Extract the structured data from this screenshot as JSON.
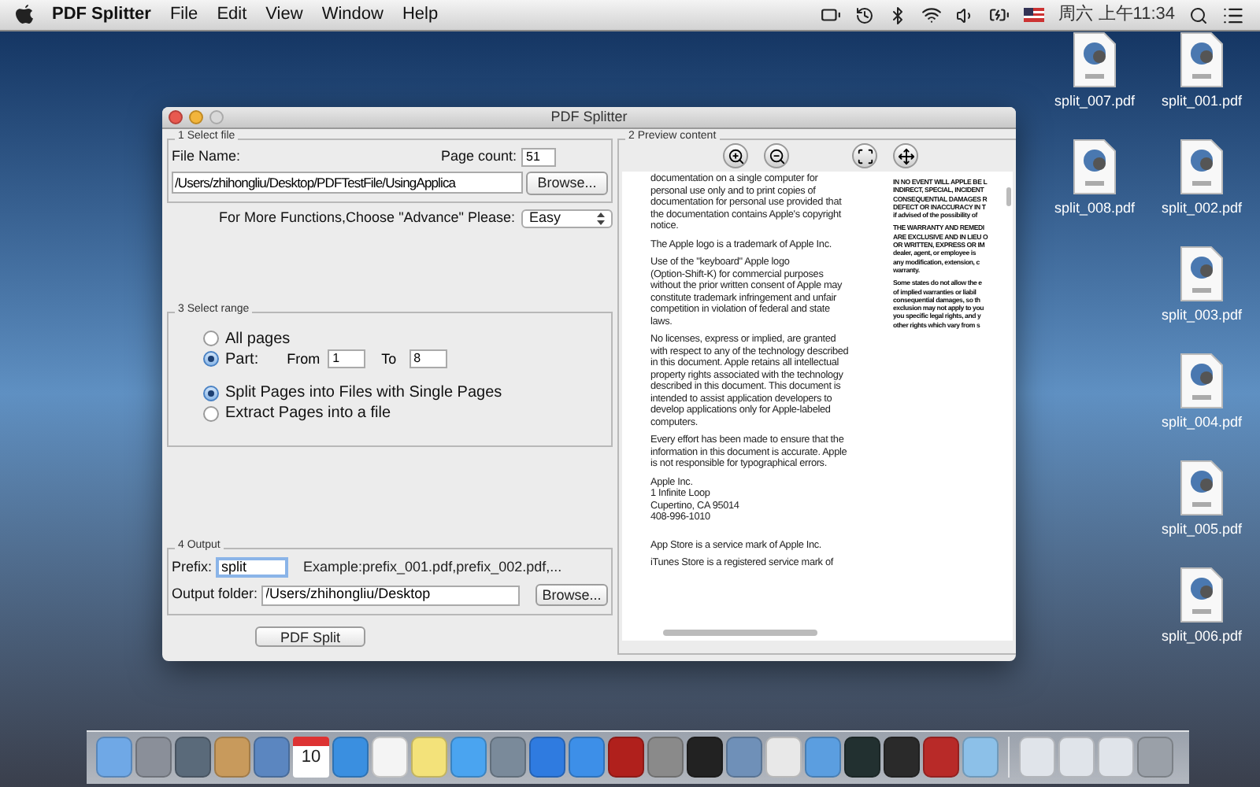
{
  "menu_bar": {
    "app_name": "PDF Splitter",
    "menus": [
      "File",
      "Edit",
      "View",
      "Window",
      "Help"
    ],
    "clock": "周六 上午11:34"
  },
  "window": {
    "title": "PDF Splitter",
    "select_file": {
      "legend": "1 Select file",
      "file_name_label": "File Name:",
      "page_count_label": "Page count:",
      "page_count": "51",
      "path": "/Users/zhihongliu/Desktop/PDFTestFile/UsingApplica",
      "browse": "Browse..."
    },
    "mode": {
      "label": "For More Functions,Choose \"Advance\" Please:",
      "value": "Easy"
    },
    "select_range": {
      "legend": "3 Select range",
      "range_options": [
        {
          "label": "All pages",
          "selected": false
        },
        {
          "label": "Part:",
          "selected": true
        }
      ],
      "from_label": "From",
      "from": "1",
      "to_label": "To",
      "to": "8",
      "split_options": [
        {
          "label": "Split Pages into Files with Single Pages",
          "selected": true
        },
        {
          "label": "Extract Pages into a file",
          "selected": false
        }
      ]
    },
    "output": {
      "legend": "4 Output",
      "prefix_label": "Prefix:",
      "prefix": "split",
      "example": "Example:prefix_001.pdf,prefix_002.pdf,...",
      "folder_label": "Output folder:",
      "folder": "/Users/zhihongliu/Desktop",
      "browse": "Browse..."
    },
    "split_button": "PDF Split",
    "preview": {
      "legend": "2 Preview content",
      "left_column": [
        [
          "documentation on a single computer for",
          "personal use only and to print copies of",
          "documentation for personal use provided that",
          "the documentation contains Apple's copyright",
          "notice."
        ],
        [
          "The Apple logo is a trademark of Apple Inc."
        ],
        [
          "Use of the \"keyboard\" Apple logo",
          "(Option-Shift-K) for commercial purposes",
          "without the prior written consent of Apple may",
          "constitute trademark infringement and unfair",
          "competition in violation of federal and state",
          "laws."
        ],
        [
          "No licenses, express or implied, are granted",
          "with respect to any of the technology described",
          "in this document. Apple retains all intellectual",
          "property rights associated with the technology",
          "described in this document. This document is",
          "intended to assist application developers to",
          "develop applications only for Apple-labeled",
          "computers."
        ],
        [
          "Every effort has been made to ensure that the",
          "information in this document is accurate. Apple",
          "is not responsible for typographical errors."
        ],
        [
          "Apple Inc.",
          "1 Infinite Loop",
          "Cupertino, CA 95014",
          "408-996-1010"
        ],
        [
          "App Store is a service mark of Apple Inc."
        ],
        [
          "iTunes Store is a registered service mark of"
        ]
      ],
      "right_column": [
        [
          "IN NO EVENT WILL APPLE BE L",
          "INDIRECT, SPECIAL, INCIDENT",
          "CONSEQUENTIAL DAMAGES R",
          "DEFECT OR INACCURACY IN T",
          "if advised of the possibility of"
        ],
        [
          "THE WARRANTY AND REMEDI",
          "ARE EXCLUSIVE AND IN LIEU O",
          "OR WRITTEN, EXPRESS OR IM",
          "dealer, agent, or employee is",
          "any modification, extension, c",
          "warranty."
        ],
        [
          "Some states do not allow the e",
          "of implied warranties or liabil",
          "consequential damages, so th",
          "exclusion may not apply to you",
          "you specific legal rights, and y",
          "other rights which vary from s"
        ]
      ]
    }
  },
  "desktop_files": [
    {
      "name": "split_007.pdf"
    },
    {
      "name": "split_001.pdf"
    },
    {
      "name": "split_008.pdf"
    },
    {
      "name": "split_002.pdf"
    },
    {
      "name": "split_003.pdf"
    },
    {
      "name": "split_004.pdf"
    },
    {
      "name": "split_005.pdf"
    },
    {
      "name": "split_006.pdf"
    }
  ],
  "dock": {
    "calendar_day": "10"
  }
}
